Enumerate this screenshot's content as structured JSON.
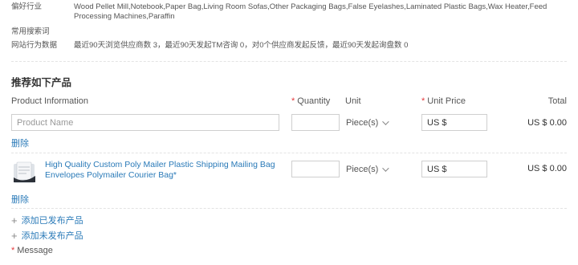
{
  "info": {
    "preferred_industry_label": "偏好行业",
    "preferred_industry_value": "Wood Pellet Mill,Notebook,Paper Bag,Living Room Sofas,Other Packaging Bags,False Eyelashes,Laminated Plastic Bags,Wax Heater,Feed Processing Machines,Paraffin",
    "search_terms_label": "常用搜索词",
    "search_terms_value": "",
    "behavior_label": "网站行为数据",
    "behavior_value": "最近90天浏览供应商数 3，最近90天发起TM咨询 0，对0个供应商发起反馈，最近90天发起询盘数 0"
  },
  "section_title": "推荐如下产品",
  "table": {
    "headers": {
      "product_info": "Product Information",
      "quantity": "Quantity",
      "unit": "Unit",
      "unit_price": "Unit Price",
      "total": "Total"
    },
    "required_mark": "*"
  },
  "rows": [
    {
      "name_placeholder": "Product Name",
      "quantity": "",
      "unit": "Piece(s)",
      "price_prefix": "US $",
      "price": "",
      "total": "US $ 0.00",
      "delete_label": "删除"
    },
    {
      "title": "High Quality Custom Poly Mailer Plastic Shipping Mailing Bag Envelopes Polymailer Courier Bag*",
      "quantity": "",
      "unit": "Piece(s)",
      "price_prefix": "US $",
      "price": "",
      "total": "US $ 0.00",
      "delete_label": "删除"
    }
  ],
  "add_published": "添加已发布产品",
  "add_unpublished": "添加未发布产品",
  "message_label": "Message",
  "icons": {
    "plus": "plus-icon",
    "chevron": "chevron-down-icon",
    "product_image": "product-thumbnail"
  },
  "colors": {
    "link": "#2a7ab8",
    "required": "#e4393c",
    "border": "#cfcfcf"
  }
}
